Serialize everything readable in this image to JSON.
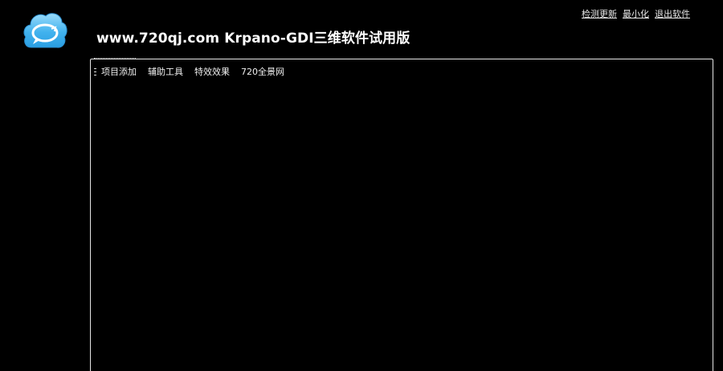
{
  "app": {
    "title": "www.720qj.com Krpano-GDI三维软件试用版"
  },
  "top_links": {
    "check_update": "检测更新",
    "minimize": "最小化",
    "exit": "退出软件"
  },
  "menu": {
    "items": [
      {
        "label": "项目添加"
      },
      {
        "label": "辅助工具"
      },
      {
        "label": "特效效果"
      },
      {
        "label": "720全景网"
      }
    ]
  },
  "colors": {
    "background": "#000000",
    "text": "#ffffff",
    "logo_blue": "#3fb0ec",
    "logo_light": "#8fd6f8"
  },
  "icons": {
    "logo": "cloud-chat-refresh-icon"
  }
}
